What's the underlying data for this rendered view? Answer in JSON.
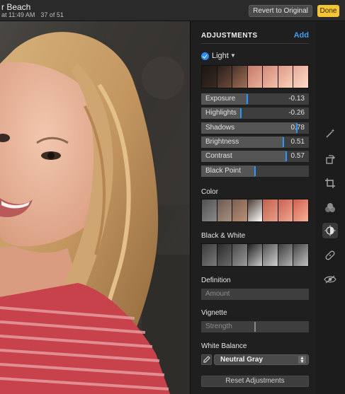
{
  "titlebar": {
    "title": "r Beach",
    "subtitle": "at 11:49 AM",
    "count": "37 of 51",
    "revert_label": "Revert to Original",
    "done_label": "Done"
  },
  "panel": {
    "title": "ADJUSTMENTS",
    "add_label": "Add",
    "light": {
      "label": "Light",
      "sliders": [
        {
          "label": "Exposure",
          "value": "-0.13",
          "level": 0.43
        },
        {
          "label": "Highlights",
          "value": "-0.26",
          "level": 0.37
        },
        {
          "label": "Shadows",
          "value": "0.78",
          "level": 0.89
        },
        {
          "label": "Brightness",
          "value": "0.51",
          "level": 0.76
        },
        {
          "label": "Contrast",
          "value": "0.57",
          "level": 0.79
        },
        {
          "label": "Black Point",
          "value": "",
          "level": 0.5
        }
      ]
    },
    "color": {
      "label": "Color"
    },
    "black_white": {
      "label": "Black & White"
    },
    "definition": {
      "label": "Definition",
      "slider_label": "Amount"
    },
    "vignette": {
      "label": "Vignette",
      "slider_label": "Strength",
      "level": 0.5
    },
    "white_balance": {
      "label": "White Balance",
      "selected": "Neutral Gray"
    },
    "reset_label": "Reset Adjustments"
  },
  "tools": [
    "magic-wand-icon",
    "rotate-icon",
    "crop-icon",
    "filters-icon",
    "adjust-icon",
    "retouch-icon",
    "red-eye-icon"
  ],
  "colors": {
    "accent": "#2f95ff",
    "done": "#f6c533",
    "add": "#3c9ff5"
  }
}
